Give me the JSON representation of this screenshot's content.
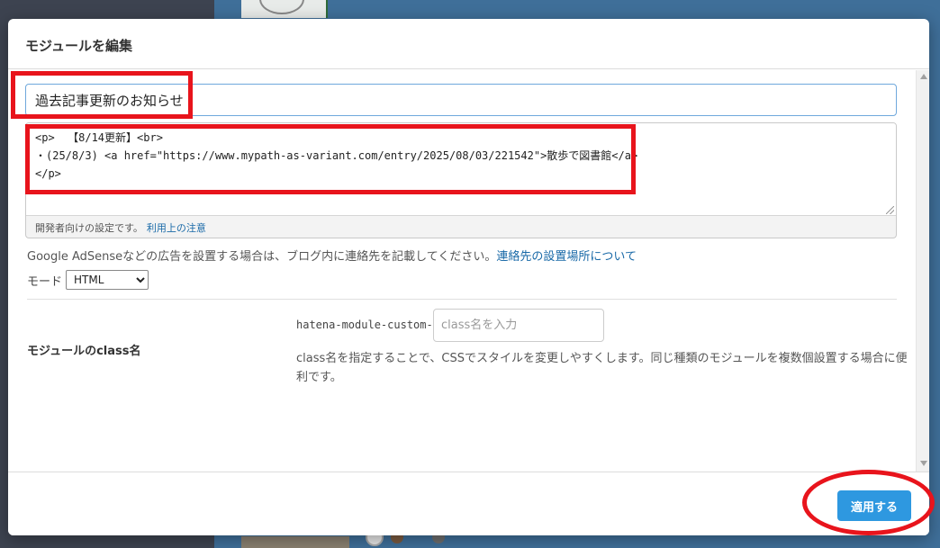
{
  "dialog": {
    "title": "モジュールを編集"
  },
  "form": {
    "module_title_value": "過去記事更新のお知らせ",
    "html_code_value": "<p>  【8/14更新】<br>\n・(25/8/3) <a href=\"https://www.mypath-as-variant.com/entry/2025/08/03/221542\">散歩で図書館</a>\n</p>",
    "dev_note_text": "開発者向けの設定です。",
    "dev_note_link": "利用上の注意",
    "adsense_note_text": "Google AdSenseなどの広告を設置する場合は、ブログ内に連絡先を記載してください。",
    "adsense_note_link": "連絡先の設置場所について",
    "mode_label": "モード",
    "mode_selected": "HTML",
    "class_label": "モジュールのclass名",
    "class_prefix": "hatena-module-custom-",
    "class_placeholder": "class名を入力",
    "class_help": "class名を指定することで、CSSでスタイルを変更しやすくします。同じ種類のモジュールを複数個設置する場合に便利です。"
  },
  "footer": {
    "apply_label": "適用する"
  },
  "colors": {
    "annotation": "#e8141c",
    "primary_button": "#2e98e0",
    "link": "#1a6aa8"
  }
}
